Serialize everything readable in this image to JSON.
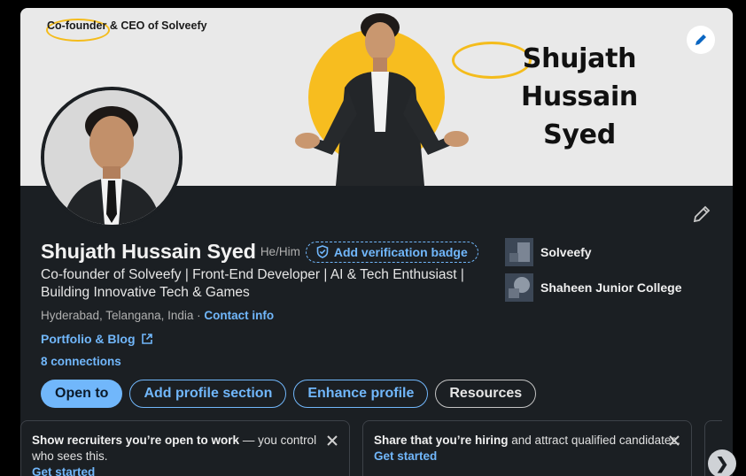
{
  "banner": {
    "tagline": "Co-founder & CEO of Solveefy",
    "name_line1": "Shujath Hussain",
    "name_line2": "Syed"
  },
  "profile": {
    "name": "Shujath Hussain Syed",
    "pronouns": "He/Him",
    "verify_label": "Add verification badge",
    "headline": "Co-founder of Solveefy | Front-End Developer | AI & Tech Enthusiast | Building Innovative Tech & Games",
    "location": "Hyderabad, Telangana, India",
    "separator": " · ",
    "contact_label": "Contact info",
    "website_label": "Portfolio & Blog",
    "connections": "8 connections"
  },
  "actions": {
    "open_to": "Open to",
    "add_section": "Add profile section",
    "enhance": "Enhance profile",
    "resources": "Resources"
  },
  "organizations": [
    {
      "name": "Solveefy"
    },
    {
      "name": "Shaheen Junior College"
    }
  ],
  "notices": [
    {
      "bold": "Show recruiters you’re open to work",
      "rest": " — you control who sees this.",
      "link": "Get started"
    },
    {
      "bold": "Share that you’re hiring",
      "rest": " and attract qualified candidates.",
      "link": "Get started"
    }
  ],
  "carousel": {
    "next_glyph": "❯"
  },
  "colors": {
    "accent": "#71b7fb",
    "card_bg": "#1b1f23",
    "banner_bg": "#e9e9e9",
    "banner_yellow": "#f7bd1f"
  }
}
